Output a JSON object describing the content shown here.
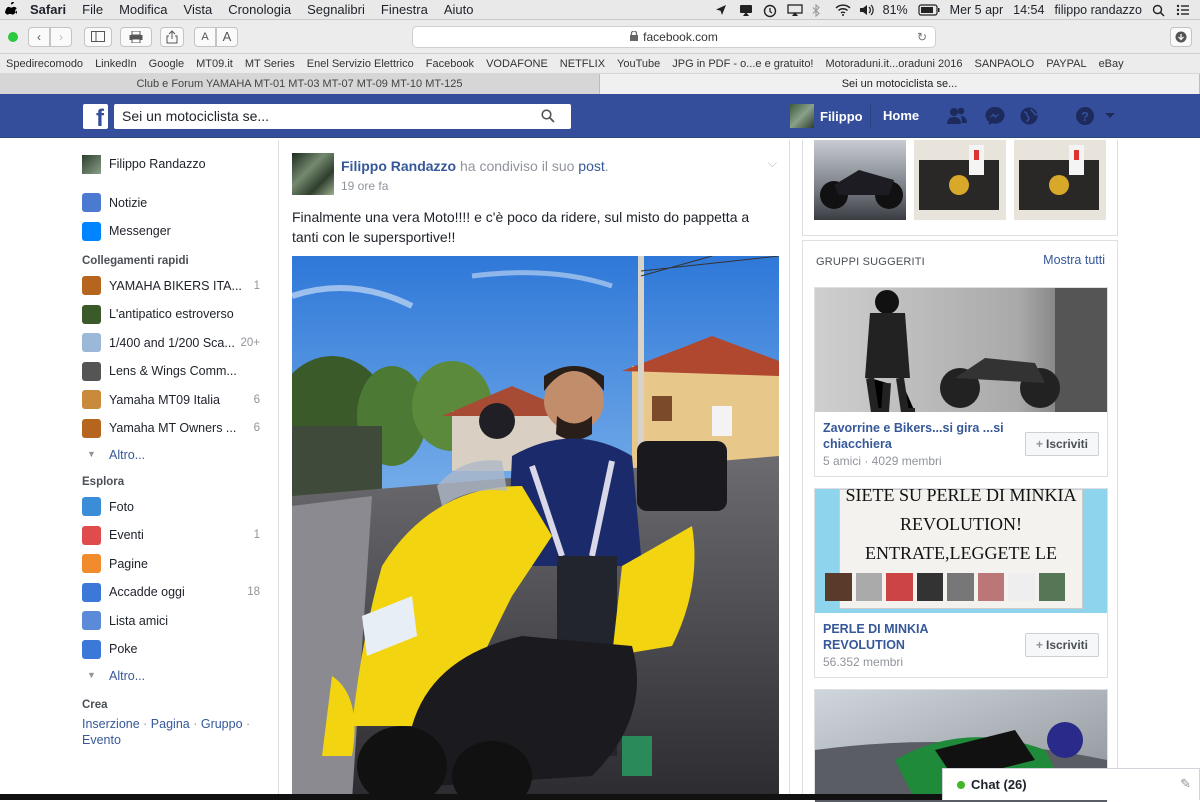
{
  "menubar": {
    "items": [
      "Safari",
      "File",
      "Modifica",
      "Vista",
      "Cronologia",
      "Segnalibri",
      "Finestra",
      "Aiuto"
    ],
    "battery": "81%",
    "date": "Mer 5 apr",
    "time": "14:54",
    "user": "filippo randazzo"
  },
  "toolbar": {
    "url": "facebook.com",
    "font_small": "A",
    "font_large": "A"
  },
  "bookmarks": [
    "Spedirecomodo",
    "LinkedIn",
    "Google",
    "MT09.it",
    "MT Series",
    "Enel Servizio Elettrico",
    "Facebook",
    "VODAFONE",
    "NETFLIX",
    "YouTube",
    "JPG in PDF - o...e e gratuito!",
    "Motoraduni.it...oraduni 2016",
    "SANPAOLO",
    "PAYPAL",
    "eBay"
  ],
  "tabs": [
    {
      "label": "Club e Forum YAMAHA MT-01 MT-03 MT-07 MT-09 MT-10 MT-125",
      "active": false
    },
    {
      "label": "Sei un motociclista se...",
      "active": true
    }
  ],
  "fb_header": {
    "logo": "f",
    "search_value": "Sei un motociclista se...",
    "user_name": "Filippo",
    "home_label": "Home"
  },
  "left_nav": {
    "profile_name": "Filippo Randazzo",
    "main": [
      {
        "label": "Notizie",
        "icon": "news-feed-icon",
        "color": "#4a7bd0"
      },
      {
        "label": "Messenger",
        "icon": "messenger-icon",
        "color": "#0084ff"
      }
    ],
    "shortcuts_title": "Collegamenti rapidi",
    "shortcuts": [
      {
        "label": "YAMAHA BIKERS ITA...",
        "count": "1",
        "color": "#b5651d"
      },
      {
        "label": "L'antipatico estroverso",
        "count": "",
        "color": "#3a5a2a"
      },
      {
        "label": "1/400 and 1/200 Sca...",
        "count": "20+",
        "color": "#9bb8d8"
      },
      {
        "label": "Lens & Wings Comm...",
        "count": "",
        "color": "#555"
      },
      {
        "label": "Yamaha MT09 Italia",
        "count": "6",
        "color": "#c98a3c"
      },
      {
        "label": "Yamaha MT Owners ...",
        "count": "6",
        "color": "#b5651d"
      }
    ],
    "shortcuts_more": "Altro...",
    "explore_title": "Esplora",
    "explore": [
      {
        "label": "Foto",
        "count": "",
        "icon": "photos-icon",
        "color": "#3b8dd8"
      },
      {
        "label": "Eventi",
        "count": "1",
        "icon": "calendar-icon",
        "color": "#e04b4b"
      },
      {
        "label": "Pagine",
        "count": "",
        "icon": "flag-icon",
        "color": "#f28a2e"
      },
      {
        "label": "Accadde oggi",
        "count": "18",
        "icon": "memories-icon",
        "color": "#3b78d8"
      },
      {
        "label": "Lista amici",
        "count": "",
        "icon": "friends-list-icon",
        "color": "#5a8ad8"
      },
      {
        "label": "Poke",
        "count": "",
        "icon": "poke-icon",
        "color": "#3b78d8"
      }
    ],
    "explore_more": "Altro...",
    "create_title": "Crea",
    "create_links": [
      "Inserzione",
      "Pagina",
      "Gruppo",
      "Evento"
    ],
    "create_sep": " · "
  },
  "post": {
    "author": "Filippo Randazzo",
    "shared_text": "ha condiviso il suo",
    "link": "post",
    "dot": ".",
    "time": "19 ore fa",
    "text": "Finalmente una vera Moto!!!! e c'è poco da ridere, sul misto do pappetta a tanti con le supersportive!!"
  },
  "right_col": {
    "suggested_title": "GRUPPI SUGGERITI",
    "show_all": "Mostra tutti",
    "groups": [
      {
        "name": "Zavorrine e Bikers...si gira ...si chiacchiera",
        "meta": "5 amici · 4029 membri",
        "join": "Iscriviti"
      },
      {
        "name": "PERLE DI MINKIA REVOLUTION",
        "meta": "56.352 membri",
        "join": "Iscriviti",
        "banner_lines": [
          "SIETE SU PERLE DI MINKIA",
          "REVOLUTION!",
          "ENTRATE,LEGGETE LE"
        ]
      },
      {
        "name": "",
        "meta": "",
        "join": ""
      }
    ]
  },
  "chat": {
    "label": "Chat (26)"
  },
  "colors": {
    "fb_blue": "#344e9c",
    "link": "#365899",
    "online": "#42b72a"
  }
}
